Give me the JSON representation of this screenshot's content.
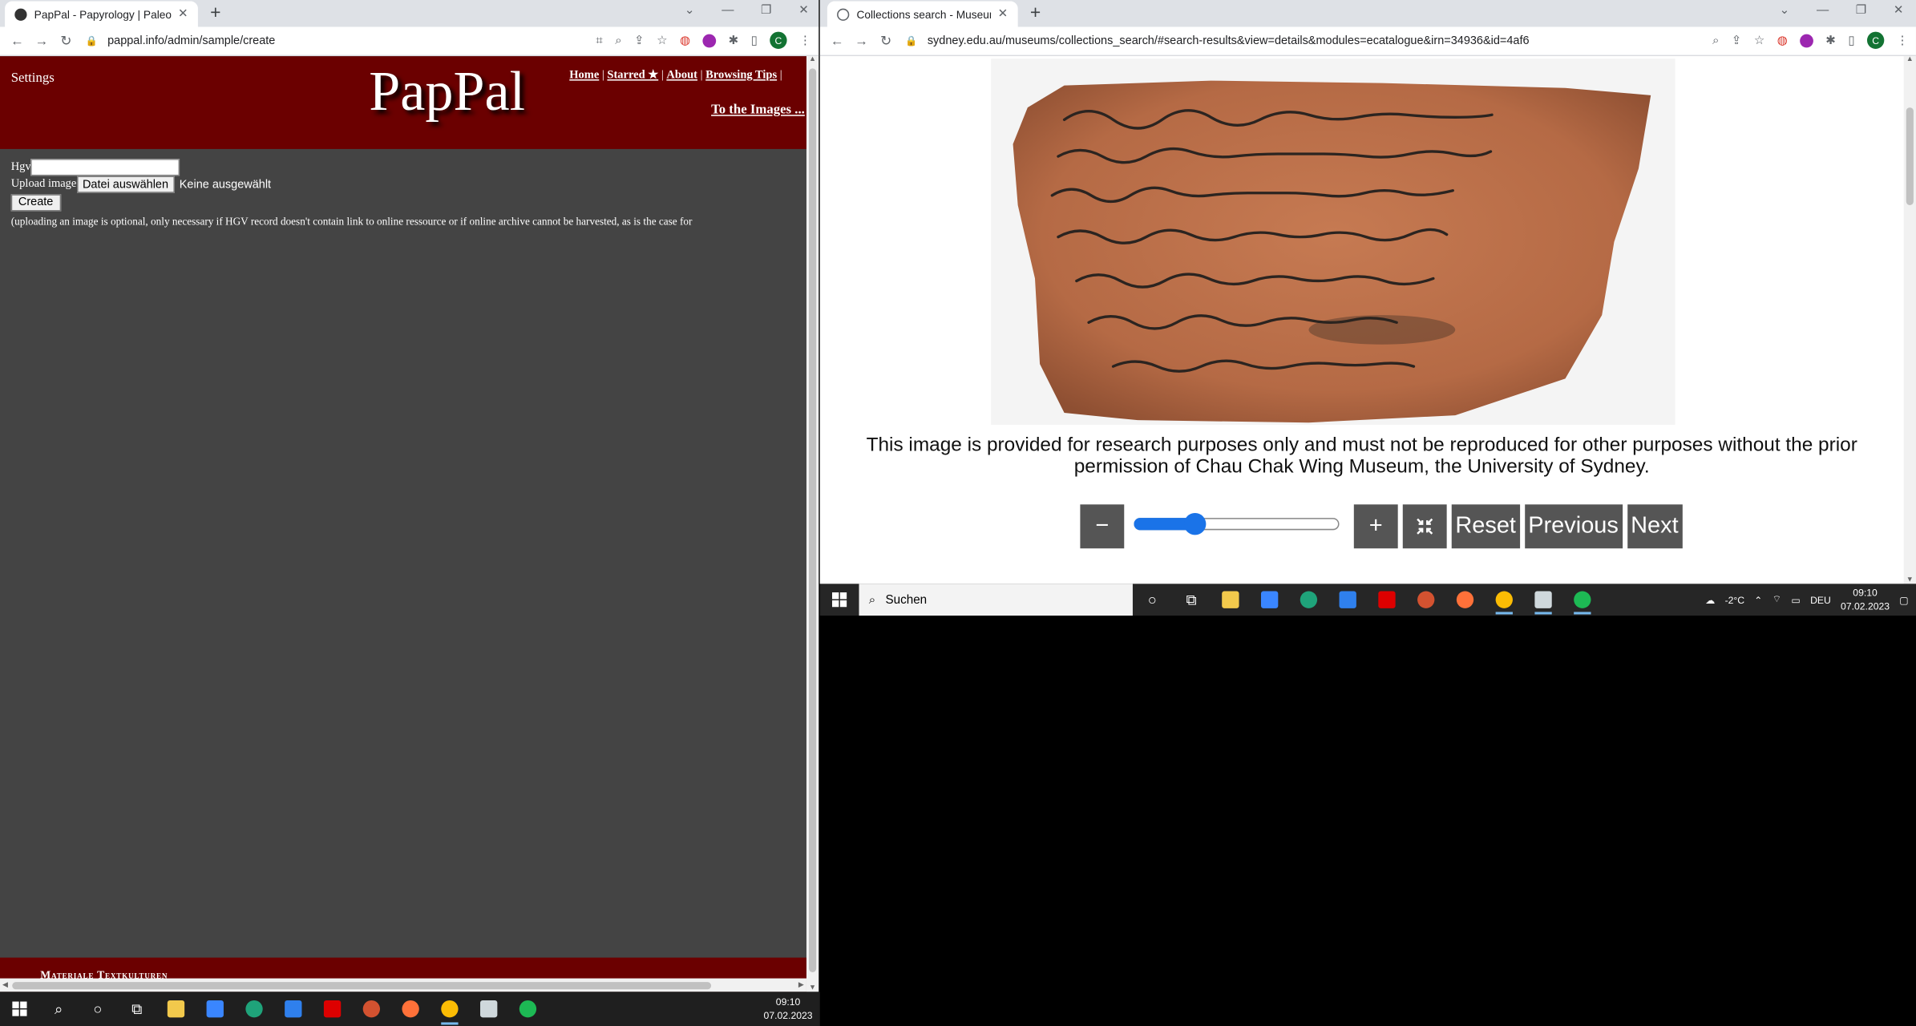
{
  "left_browser": {
    "tab_title": "PapPal - Papyrology | Paleograph",
    "url": "pappal.info/admin/sample/create",
    "page": {
      "settings": "Settings",
      "logo": "PapPal",
      "links": [
        "Home",
        "Starred ★",
        "About",
        "Browsing Tips"
      ],
      "separator": "|",
      "to_images": "To the Images ...",
      "hgv_label": "Hgv",
      "upload_label": "Upload image",
      "file_button": "Datei auswählen",
      "no_file": "Keine ausgewählt",
      "create_button": "Create",
      "note": "(uploading an image is optional, only necessary if HGV record doesn't contain link to online ressource or if online archive cannot be harvested, as is the case for",
      "footer": "Materiale Textkulturen"
    }
  },
  "right_browser": {
    "tab_title": "Collections search - Museums -",
    "url": "sydney.edu.au/museums/collections_search/#search-results&view=details&modules=ecatalogue&irn=34936&id=4af6",
    "caption": "This image is provided for research purposes only and must not be reproduced for other purposes without the prior permission of Chau Chak Wing Museum, the University of Sydney.",
    "controls": {
      "zoom_out": "−",
      "zoom_in": "+",
      "fullscreen_icon": "compress-icon",
      "reset": "Reset",
      "previous": "Previous",
      "next": "Next",
      "zoom_level": 0.27
    }
  },
  "taskbar_right": {
    "search_placeholder": "Suchen",
    "weather": "-2°C",
    "language": "DEU",
    "time": "09:10",
    "date": "07.02.2023"
  },
  "taskbar_main": {
    "time": "09:10",
    "date": "07.02.2023"
  },
  "colors": {
    "pappal_header": "#6b0000",
    "pappal_body": "#444444",
    "accent_blue": "#1a73e8",
    "control_gray": "#555555"
  }
}
